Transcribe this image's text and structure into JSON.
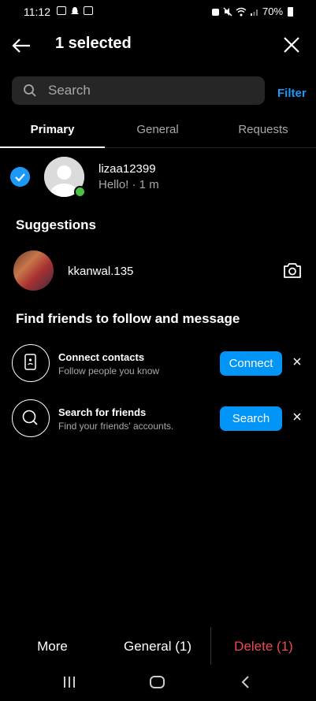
{
  "status_bar": {
    "time": "11:12",
    "battery": "70%"
  },
  "header": {
    "title": "1 selected"
  },
  "search": {
    "placeholder": "Search",
    "filter_label": "Filter"
  },
  "tabs": [
    {
      "label": "Primary",
      "active": true
    },
    {
      "label": "General",
      "active": false
    },
    {
      "label": "Requests",
      "active": false
    }
  ],
  "chat": {
    "username": "lizaa12399",
    "preview": "Hello! · 1 m",
    "selected": true,
    "online": true
  },
  "suggestions": {
    "title": "Suggestions",
    "items": [
      {
        "username": "kkanwal.135"
      }
    ]
  },
  "find_friends": {
    "title": "Find friends to follow and message",
    "items": [
      {
        "title": "Connect contacts",
        "subtitle": "Follow people you know",
        "button": "Connect"
      },
      {
        "title": "Search for friends",
        "subtitle": "Find your friends' accounts.",
        "button": "Search"
      }
    ]
  },
  "actions": {
    "more": "More",
    "general": "General (1)",
    "delete": "Delete (1)"
  },
  "colors": {
    "accent": "#0095f6",
    "link": "#1c98f7",
    "delete": "#ed4956",
    "online": "#4cc242"
  }
}
